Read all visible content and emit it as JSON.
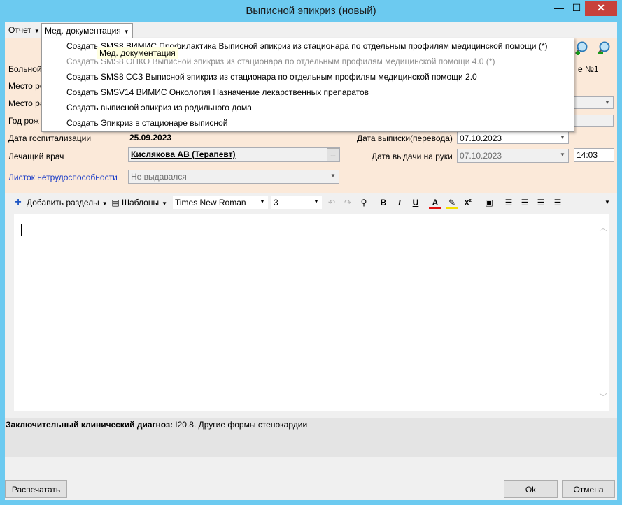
{
  "window": {
    "title": "Выписной эпикриз (новый)",
    "controls": {
      "minimize": "—",
      "maximize": "☐",
      "close": "✕"
    }
  },
  "menubar": {
    "report": "Отчет",
    "med_docs": "Мед. документация"
  },
  "dropdown": {
    "items": [
      {
        "label": "Создать SMS8 ВИМИС Профилактика Выписной эпикриз из стационара по отдельным профилям медицинской помощи (*)",
        "enabled": true
      },
      {
        "label": "Создать SMS8 ОНКО Выписной эпикриз из стационара по отдельным профилям медицинской помощи 4.0 (*)",
        "enabled": false
      },
      {
        "label": "Создать SMS8 ССЗ Выписной эпикриз из стационара по отдельным профилям медицинской помощи 2.0",
        "enabled": true
      },
      {
        "label": "Создать SMSV14 ВИМИС Онкология Назначение лекарственных препаратов",
        "enabled": true
      },
      {
        "label": "Создать выписной эпикриз из родильного дома",
        "enabled": true
      },
      {
        "label": "Создать Эпикриз в стационаре выписной",
        "enabled": true
      }
    ],
    "tooltip": "Мед. документация"
  },
  "form": {
    "labels": {
      "patient": "Больной",
      "place_res": "Место ре",
      "place_work": "Место ра",
      "birth_year": "Год рож",
      "hosp_date": "Дата госпитализации",
      "doctor": "Лечащий врач",
      "sick_leave": "Листок нетрудоспособности",
      "discharge_date": "Дата выписки(перевода)",
      "handout_date": "Дата выдачи на руки",
      "ward": "е №1"
    },
    "values": {
      "hosp_date": "25.09.2023",
      "doctor": "Кислякова АВ (Терапевт)",
      "sick_leave": "Не выдавался",
      "discharge_date": "07.10.2023",
      "handout_date": "07.10.2023",
      "handout_time": "14:03"
    }
  },
  "toolbar": {
    "add_sections": "Добавить разделы",
    "templates": "Шаблоны",
    "font": "Times New Roman",
    "size": "3",
    "bold": "B",
    "italic": "I",
    "underline": "U",
    "color_a": "A",
    "superscript": "x²"
  },
  "diagnosis": {
    "label": "Заключительный клинический диагноз:",
    "value": " I20.8. Другие формы стенокардии"
  },
  "buttons": {
    "print": "Распечатать",
    "ok": "Ok",
    "cancel": "Отмена"
  },
  "colors": {
    "titlebar": "#6ccaf0",
    "form_bg": "#fbe9d9",
    "link": "#1a3cc7"
  }
}
